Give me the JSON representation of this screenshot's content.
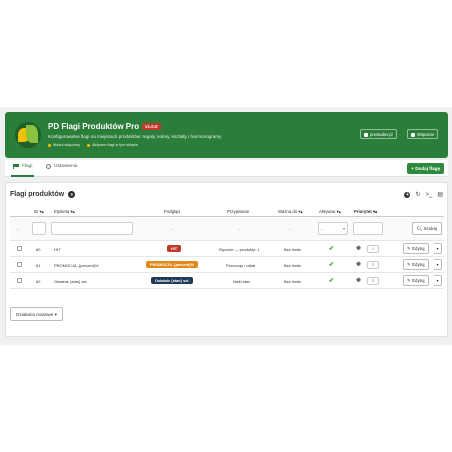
{
  "header": {
    "title": "PD Flagi Produktów Pro",
    "version": "v1.0.0",
    "description": "Konfigurowalne flagi na miejscach produktów: reguły, kolory, kształty i harmonogramy",
    "flags": [
      "Moduł włączony",
      "Aktywne flagi w tym sklepie"
    ],
    "links": [
      "prestadev.pl",
      "Wsparcie"
    ]
  },
  "tabs": [
    {
      "label": "Flagi",
      "active": true,
      "icon": "flag-icon"
    },
    {
      "label": "Ustawienia",
      "active": false,
      "icon": "gear-icon"
    }
  ],
  "add_flag_button": "+ Dodaj flagę",
  "panel": {
    "title": "Flagi produktów",
    "count": "3"
  },
  "columns": [
    "ID",
    "Etykieta",
    "Podgląd",
    "Przypisanie",
    "Ważna do",
    "Aktywna",
    "Priorytet"
  ],
  "filters": {
    "dash": "--",
    "search_button": "Szukaj"
  },
  "rows": [
    {
      "id": "60",
      "label": "HIT",
      "preview": "HIT",
      "preview_color": "#c0392b",
      "assignment": "Ręcznie — produkty: 1",
      "valid_to": "Bez limitu",
      "priority": "1",
      "edit": "Edytuj"
    },
    {
      "id": "61",
      "label": "PROMOCJA -{percent}%",
      "preview": "PROMOCJA -{percent}%",
      "preview_color": "#e08a1e",
      "assignment": "Promocja / rabat",
      "valid_to": "Bez limitu",
      "priority": "2",
      "edit": "Edytuj"
    },
    {
      "id": "62",
      "label": "Ostatnie {stan} szt.",
      "preview": "Ostatnie {stan} szt.",
      "preview_color": "#1f3b5a",
      "assignment": "Niski stan",
      "valid_to": "Bez limitu",
      "priority": "3",
      "edit": "Edytuj"
    }
  ],
  "bulk_actions": "Działania masowe"
}
